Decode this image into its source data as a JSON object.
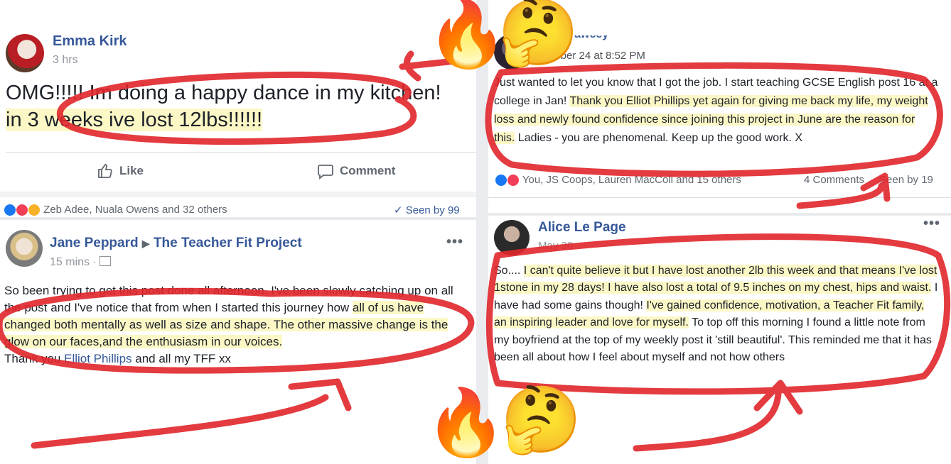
{
  "posts": {
    "p1": {
      "author": "Emma Kirk",
      "time": "3 hrs",
      "text_plain": "OMG!!!!! Im doing a happy dance in my kitchen! ",
      "text_highlight": "in 3 weeks ive lost 12lbs!!!!!!",
      "like_label": "Like",
      "comment_label": "Comment",
      "reactions": "Zeb Adee, Nuala Owens and 32 others",
      "seen": "✓ Seen by 99"
    },
    "p2": {
      "author": "Ison Fawcey",
      "time": "October 24 at 8:52 PM",
      "text_a": "Just wanted to let you know that I got the job. I start teaching GCSE English post 16 at a college in Jan! ",
      "text_b": "Thank you Elliot Phillips yet again for giving me back my life, my weight loss and newly found confidence since joining this project in June are the reason for this.",
      "text_c": " Ladies - you are phenomenal. Keep up the good work. X",
      "reactions": "You, JS Coops, Lauren MacColl and 15 others",
      "comments": "4 Comments",
      "seen": "Seen by 19"
    },
    "p3": {
      "author": "Jane Peppard",
      "group": "The Teacher Fit Project",
      "time": "15 mins ·",
      "text_a": "So been trying to get this post done all afternoon. I've been slowly catching up on all the post and I've notice that from when I started this journey how ",
      "text_b": "all of us have changed both mentally as well as size and shape. The other massive change is the glow on our faces,and the enthusiasm in our voices.",
      "text_c": "Thank you ",
      "text_link": "Elliot Phillips",
      "text_d": " and all my TFF xx",
      "more": "•••"
    },
    "p4": {
      "author": "Alice Le Page",
      "time": "May 30",
      "text_a": "So.... ",
      "text_b": "I can't quite believe it but I have lost another 2lb this week and that means I've lost 1stone in my 28 days! I have also lost a total of 9.5 inches on my chest, hips and waist.",
      "text_c": " I have had some gains though! ",
      "text_d": "I've gained confidence, motivation, a Teacher Fit family, an inspiring leader and love for myself.",
      "text_e": " To top off this morning I found a little note from my boyfriend at the top of my weekly post it 'still beautiful'. This reminded me that it has been all about how I feel about myself and not how others",
      "more": "•••"
    }
  },
  "emoji": {
    "fire": "🔥",
    "thinking": "🤔"
  },
  "colors": {
    "link": "#365899",
    "highlight": "#fcf8c6",
    "annotation": "#e0262b"
  }
}
